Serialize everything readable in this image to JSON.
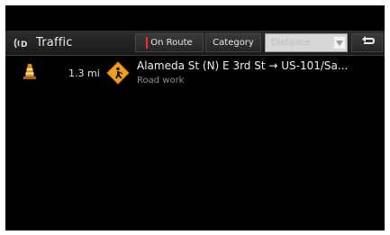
{
  "header": {
    "title": "Traffic",
    "icon": "traffic-radio-icon"
  },
  "toolbar": {
    "on_route_label": "On Route",
    "category_label": "Category",
    "sort_dropdown": {
      "selected": "Distance",
      "enabled": false
    },
    "back_icon": "back-arrow-icon"
  },
  "incidents": [
    {
      "distance": "1.3 mi",
      "route": "Alameda St (N) E 3rd St → US-101/Sa...",
      "type": "Road work",
      "icons": [
        "traffic-cone-icon",
        "road-work-sign-icon"
      ]
    }
  ],
  "colors": {
    "accent_red": "#ff2a2a",
    "sign_orange": "#f0a020"
  }
}
